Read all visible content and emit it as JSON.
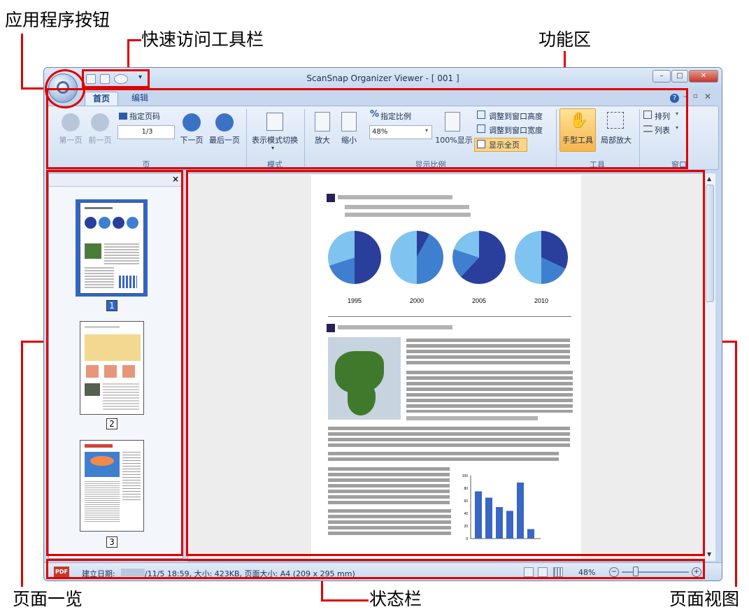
{
  "callouts": {
    "app_button": "应用程序按钮",
    "quick_access": "快速访问工具栏",
    "ribbon": "功能区",
    "page_list": "页面一览",
    "status_bar": "状态栏",
    "page_view": "页面视图"
  },
  "window": {
    "title": "ScanSnap Organizer Viewer - [ 001 ]"
  },
  "tabs": [
    "首页",
    "编辑"
  ],
  "ribbon": {
    "page_group": {
      "label": "页",
      "first": "第一页",
      "prev": "前一页",
      "specify_page": "指定页码",
      "page_value": "1/3",
      "next": "下一页",
      "last": "最后一页"
    },
    "mode_group": {
      "label": "模式",
      "switch": "表示模式切换"
    },
    "zoom_group": {
      "label": "显示比例",
      "zoom_in": "放大",
      "zoom_out": "缩小",
      "specify_ratio": "指定比例",
      "ratio_value": "48%",
      "hundred": "100%显示",
      "fit_height": "调整到窗口高度",
      "fit_width": "调整到窗口宽度",
      "fit_page": "显示全页"
    },
    "tool_group": {
      "label": "工具",
      "hand": "手型工具",
      "partial_zoom": "局部放大"
    },
    "window_group": {
      "label": "窗口",
      "arrange": "排列",
      "list": "列表"
    }
  },
  "thumbnails": [
    "1",
    "2",
    "3"
  ],
  "status": {
    "pdf_badge": "PDF",
    "created_label": "建立日期:",
    "info": "/11/5 18:59, 大小: 423KB, 页面大小: A4 (209 x 295 mm)",
    "zoom": "48%"
  },
  "chart_data": [
    {
      "type": "pie",
      "categories": [
        "1995",
        "2000",
        "2005",
        "2010"
      ]
    },
    {
      "type": "bar",
      "y_ticks": [
        "0",
        "20",
        "40",
        "60",
        "80",
        "100"
      ],
      "ylim": [
        0,
        100
      ],
      "values": [
        75,
        65,
        50,
        44,
        89,
        15
      ]
    }
  ],
  "colors": {
    "highlight_red": "#e00000",
    "pie_dark": "#2a3f9c",
    "pie_mid": "#3f7fd0",
    "pie_light": "#7fc3f0",
    "bar_blue": "#3a66c4"
  }
}
